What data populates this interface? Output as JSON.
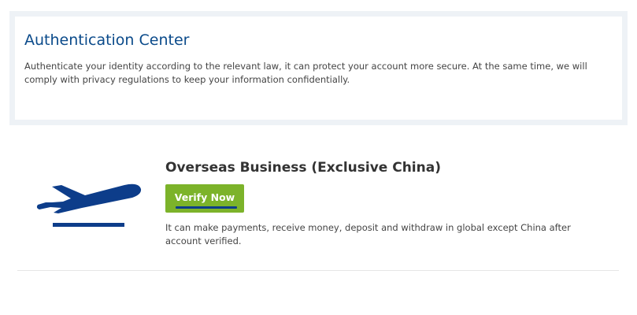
{
  "auth": {
    "title": "Authentication Center",
    "description": "Authenticate your identity according to the relevant law, it can protect your account more secure. At the same time, we will comply with privacy regulations to keep your information confidentially."
  },
  "business": {
    "icon": "airplane-takeoff-icon",
    "title": "Overseas Business (Exclusive China)",
    "verify_label": "Verify Now",
    "description": "It can make payments, receive money, deposit and withdraw in global except China after account verified."
  },
  "colors": {
    "title_blue": "#0a4a8a",
    "plane_blue": "#0d3d8a",
    "button_green": "#7cb32a",
    "panel_border": "#eef2f6"
  }
}
